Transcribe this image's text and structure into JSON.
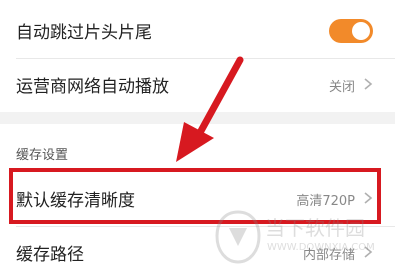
{
  "settings": {
    "auto_skip": {
      "label": "自动跳过片头片尾",
      "enabled": true
    },
    "carrier_autoplay": {
      "label": "运营商网络自动播放",
      "value": "关闭"
    },
    "cache_section": {
      "title": "缓存设置"
    },
    "default_cache_quality": {
      "label": "默认缓存清晰度",
      "value": "高清720P"
    },
    "cache_path": {
      "label": "缓存路径",
      "value": "内部存储"
    }
  },
  "watermark": {
    "text": "当下软件园",
    "url": "WWW.DOWNXIA.COM"
  },
  "colors": {
    "toggle_on": "#f28a2a",
    "highlight": "#d71920",
    "arrow": "#d71920"
  }
}
